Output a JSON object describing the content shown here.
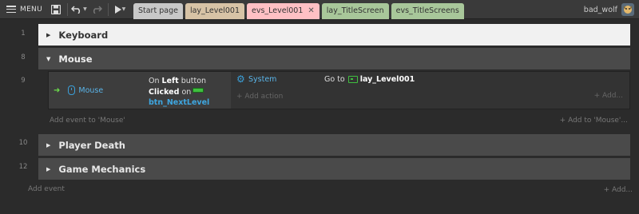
{
  "toolbar": {
    "menu_label": "MENU",
    "save_icon": "save-icon",
    "undo_icon": "undo-icon",
    "redo_icon": "redo-icon",
    "play_icon": "play-icon"
  },
  "tabs": [
    {
      "label": "Start page",
      "color": "#c8c8c8",
      "active": false
    },
    {
      "label": "lay_Level001",
      "color": "#d7c3a6",
      "active": false
    },
    {
      "label": "evs_Level001",
      "color": "#ffc0c4",
      "active": true,
      "close": "✕"
    },
    {
      "label": "lay_TitleScreen",
      "color": "#a8c79a",
      "active": false
    },
    {
      "label": "evs_TitleScreens",
      "color": "#a8c79a",
      "active": false
    }
  ],
  "user": {
    "name": "bad_wolf"
  },
  "rows": {
    "keyboard": {
      "num": "1",
      "title": "Keyboard"
    },
    "mouse": {
      "num": "8",
      "title": "Mouse"
    },
    "event_num": "9",
    "player_death": {
      "num": "10",
      "title": "Player Death"
    },
    "game_mechanics": {
      "num": "12",
      "title": "Game Mechanics"
    }
  },
  "event": {
    "condition_object": "Mouse",
    "cond_on": "On",
    "cond_button": "Left",
    "cond_button_suffix": "button",
    "cond_clicked": "Clicked",
    "cond_on2": "on",
    "cond_target": "btn_NextLevel",
    "action_object": "System",
    "action_text": "Go to",
    "action_target": "lay_Level001",
    "add_action": "+ Add action",
    "add_dots": "+ Add..."
  },
  "footer": {
    "add_event_to_mouse": "Add event to 'Mouse'",
    "add_to_mouse": "+ Add to 'Mouse'...",
    "add_event": "Add event",
    "add_dots": "+ Add..."
  }
}
